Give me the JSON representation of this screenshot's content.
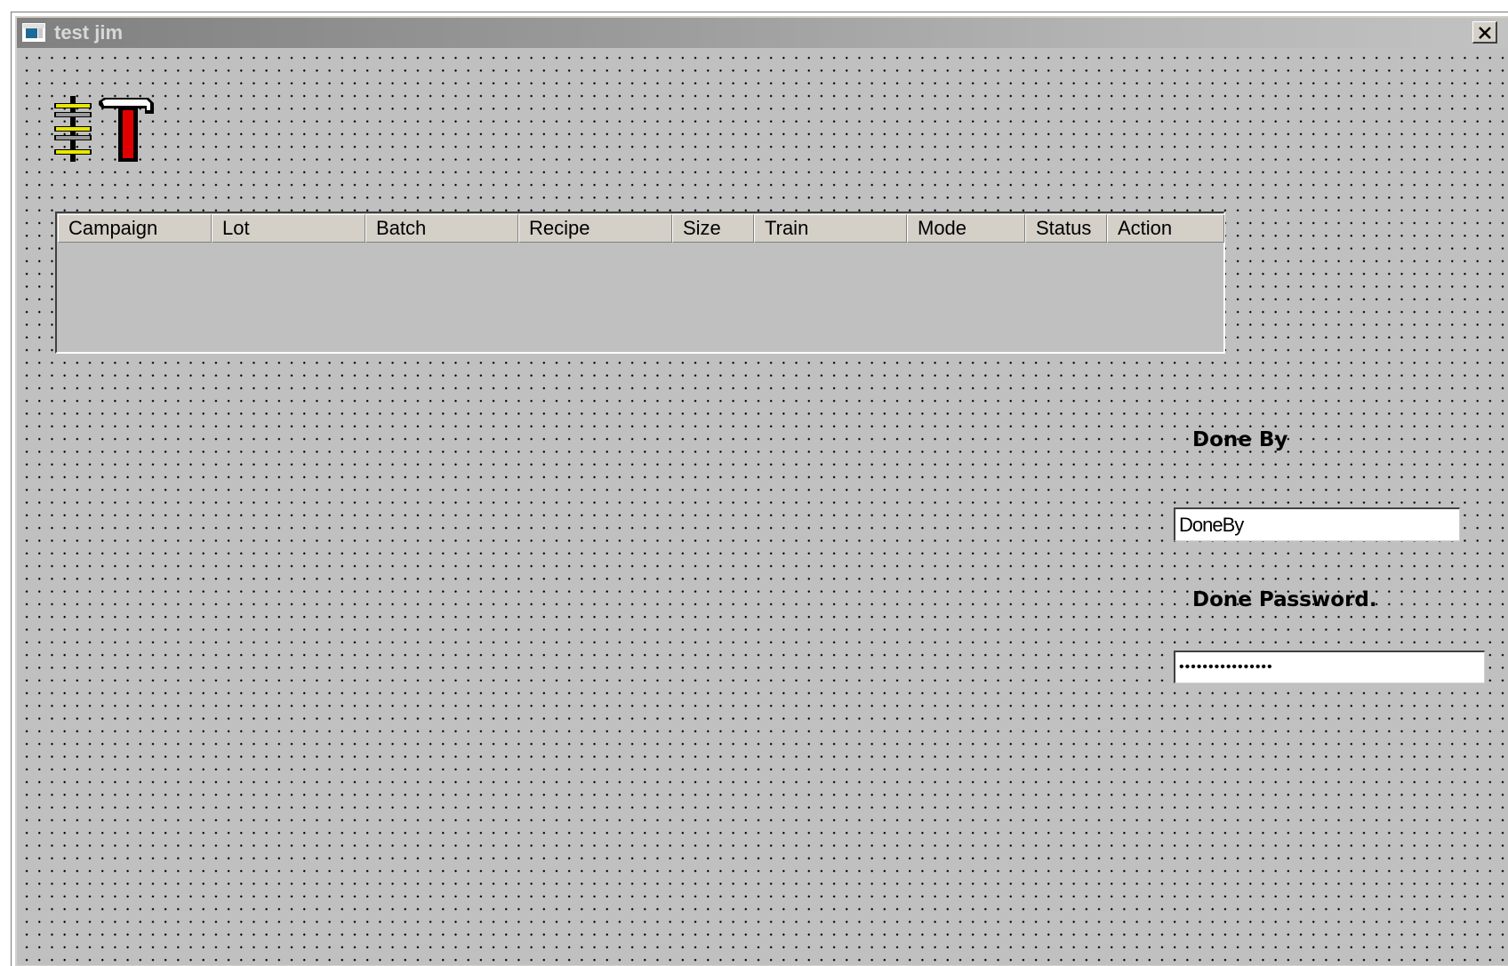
{
  "window": {
    "title": "test jim",
    "close_glyph": "✕"
  },
  "toolbox_icon": "toolbox-hammer-icon",
  "table": {
    "columns": [
      {
        "label": "Campaign"
      },
      {
        "label": "Lot"
      },
      {
        "label": "Batch"
      },
      {
        "label": "Recipe"
      },
      {
        "label": "Size"
      },
      {
        "label": "Train"
      },
      {
        "label": "Mode"
      },
      {
        "label": "Status"
      },
      {
        "label": "Action"
      }
    ],
    "rows": []
  },
  "done_by": {
    "label": "Done By",
    "value": "DoneBy"
  },
  "done_password": {
    "label": "Done Password.",
    "value": "••••••••••••••••"
  },
  "colors": {
    "client_bg": "#c0c0c0",
    "frame": "#d4d0c8",
    "hammer_handle": "#e00000",
    "pegs": "#e8e800"
  }
}
